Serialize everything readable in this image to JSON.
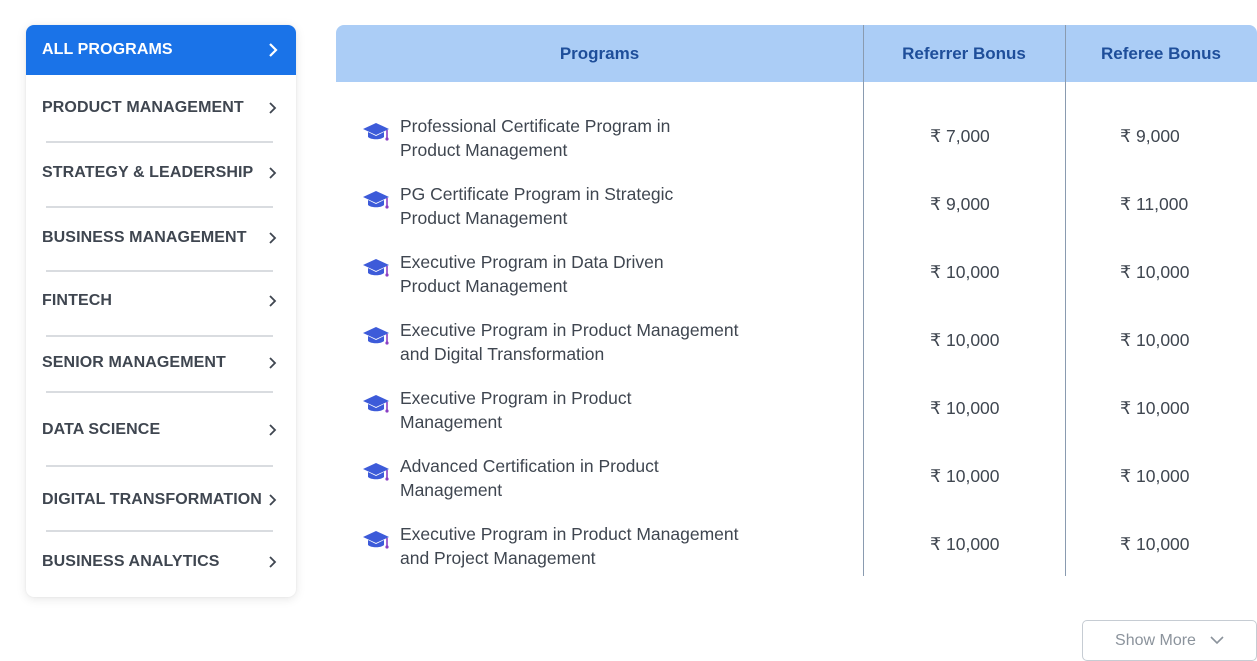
{
  "sidebar": {
    "items": [
      {
        "label": "ALL PROGRAMS",
        "active": true
      },
      {
        "label": "PRODUCT MANAGEMENT"
      },
      {
        "label": "STRATEGY & LEADERSHIP"
      },
      {
        "label": "BUSINESS MANAGEMENT"
      },
      {
        "label": "FINTECH"
      },
      {
        "label": "SENIOR MANAGEMENT"
      },
      {
        "label": "DATA SCIENCE"
      },
      {
        "label": "DIGITAL TRANSFORMATION"
      },
      {
        "label": "BUSINESS ANALYTICS"
      }
    ]
  },
  "table": {
    "headers": {
      "programs": "Programs",
      "referrer": "Referrer Bonus",
      "referee": "Referee Bonus"
    },
    "rows": [
      {
        "line1": "Professional Certificate Program in",
        "line2": "Product Management",
        "referrer": "₹ 7,000",
        "referee": "₹ 9,000"
      },
      {
        "line1": "PG Certificate Program in Strategic",
        "line2": "Product Management",
        "referrer": "₹ 9,000",
        "referee": "₹ 11,000"
      },
      {
        "line1": "Executive Program in Data Driven",
        "line2": "Product Management",
        "referrer": "₹ 10,000",
        "referee": "₹ 10,000"
      },
      {
        "line1": "Executive Program in Product Management",
        "line2": "and Digital Transformation",
        "referrer": "₹ 10,000",
        "referee": "₹ 10,000"
      },
      {
        "line1": "Executive Program in Product",
        "line2": "Management",
        "referrer": "₹ 10,000",
        "referee": "₹ 10,000"
      },
      {
        "line1": "Advanced Certification in Product",
        "line2": "Management",
        "referrer": "₹ 10,000",
        "referee": "₹ 10,000"
      },
      {
        "line1": "Executive Program in Product Management",
        "line2": "and Project Management",
        "referrer": "₹ 10,000",
        "referee": "₹ 10,000"
      }
    ]
  },
  "show_more": {
    "label": "Show More"
  },
  "icons": {
    "program": "graduation-cap-icon",
    "nav": "chevron-right-icon",
    "expand": "chevron-down-icon"
  },
  "colors": {
    "accent": "#1a73e8",
    "header_bg": "#abcdf6",
    "header_text": "#1e4e9a",
    "cap_icon": "#3d5bd9"
  }
}
